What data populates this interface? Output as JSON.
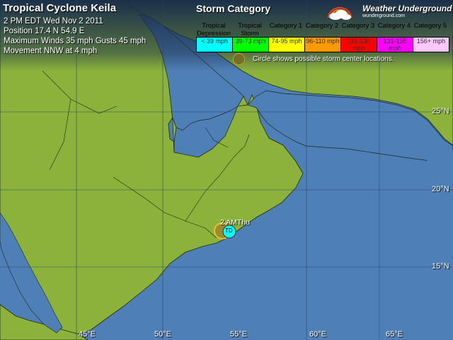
{
  "storm": {
    "title": "Tropical Cyclone Keila",
    "time_line": "2 PM EDT Wed Nov 2 2011",
    "position_line": "Position 17.4 N 54.9 E",
    "winds_line": "Maximum Winds  35 mph  Gusts  45 mph",
    "movement_line": "Movement NNW at 4 mph"
  },
  "legend": {
    "title": "Storm Category",
    "categories": [
      {
        "label": "Tropical Depression",
        "range": "< 39 mph",
        "color": "#00ffff"
      },
      {
        "label": "Tropical Storm",
        "range": "39-73 mph",
        "color": "#00ff00"
      },
      {
        "label": "Category 1",
        "range": "74-95 mph",
        "color": "#ffff00"
      },
      {
        "label": "Category 2",
        "range": "96-110 mph",
        "color": "#ff9900"
      },
      {
        "label": "Category 3",
        "range": "111-130 mph",
        "color": "#ff0000"
      },
      {
        "label": "Category 4",
        "range": "131-155 mph",
        "color": "#ff00ff"
      },
      {
        "label": "Category 5",
        "range": "156+ mph",
        "color": "#ffc8ff"
      }
    ],
    "circle_note": "Circle shows possible storm center locations."
  },
  "logo": {
    "brand": "Weather Underground",
    "domain": "wunderground.com",
    "icon": "rainbow-cloud-icon"
  },
  "grid": {
    "latitudes": [
      "25°N",
      "20°N",
      "15°N"
    ],
    "longitudes": [
      "45°E",
      "50°E",
      "55°E",
      "60°E",
      "65°E"
    ]
  },
  "forecast_point": {
    "time": "2 AMThu",
    "marker": "TD",
    "marker_color": "#00ffff",
    "uncertainty_color": "#d4b01e"
  },
  "colors": {
    "ocean": "#4f7fb7",
    "land": "#8cb23b",
    "dark_land": "#2c4565"
  }
}
